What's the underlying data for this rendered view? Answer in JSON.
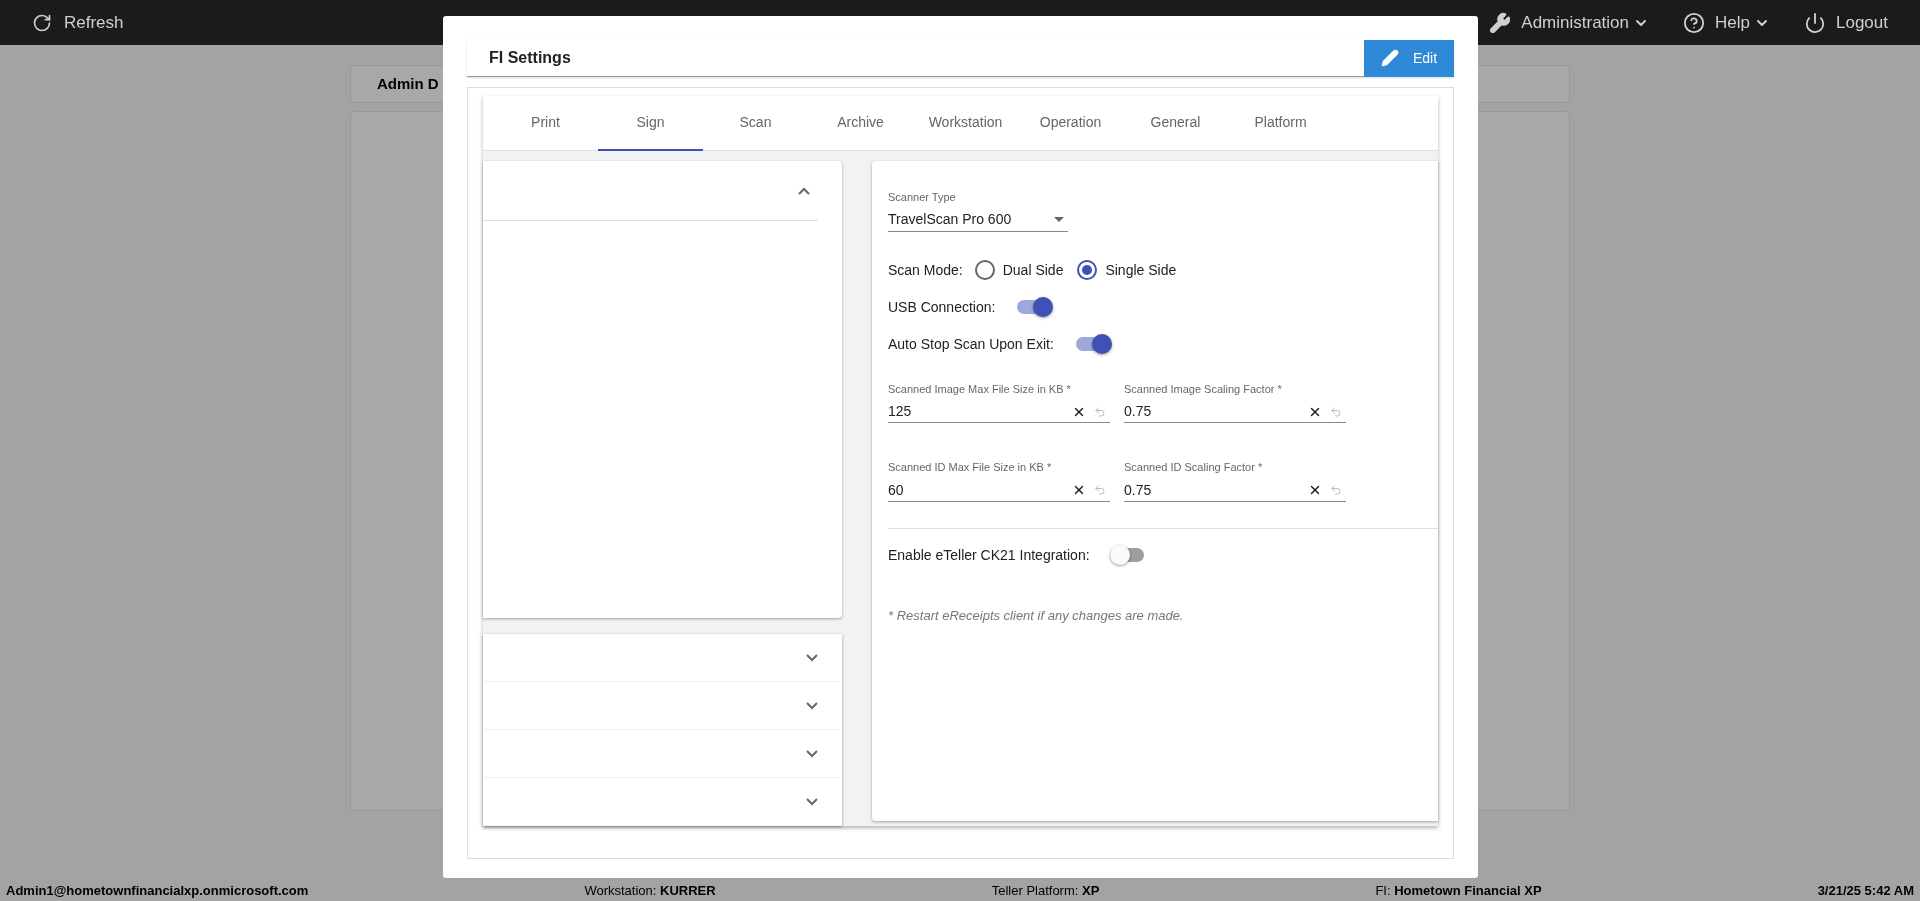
{
  "top_bar": {
    "refresh": "Refresh",
    "menus": [
      {
        "kind": "wrench",
        "label": "Administration",
        "dropdown": true
      },
      {
        "kind": "help",
        "label": "Help",
        "dropdown": true
      },
      {
        "kind": "power",
        "label": "Logout",
        "dropdown": false
      }
    ]
  },
  "page": {
    "card_title": "Admin D"
  },
  "status_bar": [
    {
      "kind": "user",
      "text": "Admin1@hometownfinancialxp.onmicrosoft.com"
    },
    {
      "kind": "info",
      "text": "Workstation: **KURRER**"
    },
    {
      "kind": "info",
      "text": "Teller Platform: **XP**"
    },
    {
      "kind": "info",
      "text": "FI: **Hometown Financial XP**"
    },
    {
      "kind": "time",
      "text": "3/21/25 5:42 AM"
    }
  ],
  "dialog": {
    "title": "FI Settings",
    "edit_button": "Edit",
    "tabs": [
      {
        "label": "Print",
        "selected": false
      },
      {
        "label": "Sign",
        "selected": true
      },
      {
        "label": "Scan",
        "selected": false
      },
      {
        "label": "Archive",
        "selected": false
      },
      {
        "label": "Workstation",
        "selected": false
      },
      {
        "label": "Operation",
        "selected": false
      },
      {
        "label": "General",
        "selected": false
      },
      {
        "label": "Platform",
        "selected": false
      }
    ],
    "sections": [
      {
        "expanded": true
      },
      {
        "expanded": false
      },
      {
        "expanded": false
      },
      {
        "expanded": false
      },
      {
        "expanded": false
      }
    ],
    "scanner_type": {
      "label": "Scanner Type",
      "value": "TravelScan Pro 600"
    },
    "scan_mode": {
      "label": "Scan Mode:",
      "options": [
        {
          "label": "Dual Side",
          "selected": false
        },
        {
          "label": "Single Side",
          "selected": true
        }
      ]
    },
    "toggles": [
      {
        "label": "USB Connection:",
        "on": true
      },
      {
        "label": "Auto Stop Scan Upon Exit:",
        "on": true
      }
    ],
    "fields": [
      {
        "label": "Scanned Image Max File Size in KB *",
        "value": "125"
      },
      {
        "label": "Scanned Image Scaling Factor *",
        "value": "0.75"
      },
      {
        "label": "Scanned ID Max File Size in KB *",
        "value": "60"
      },
      {
        "label": "Scanned ID Scaling Factor *",
        "value": "0.75"
      }
    ],
    "integration": {
      "label": "Enable eTeller CK21 Integration:",
      "on": false
    },
    "note": "* Restart eReceipts client if any changes are made."
  }
}
